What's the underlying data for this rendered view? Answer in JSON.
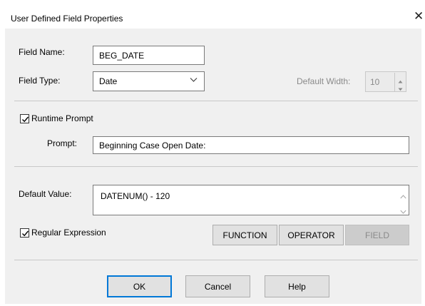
{
  "dialog": {
    "title": "User Defined Field Properties",
    "close_glyph": "✕"
  },
  "field_name": {
    "label": "Field Name:",
    "value": "BEG_DATE"
  },
  "field_type": {
    "label": "Field Type:",
    "value": "Date"
  },
  "default_width": {
    "label": "Default Width:",
    "value": "10",
    "enabled": false
  },
  "runtime_prompt": {
    "label": "Runtime Prompt",
    "checked": true
  },
  "prompt": {
    "label": "Prompt:",
    "value": "Beginning Case Open Date:"
  },
  "default_value": {
    "label": "Default Value:",
    "value": "DATENUM() - 120"
  },
  "regular_expression": {
    "label": "Regular Expression",
    "checked": true
  },
  "expression_buttons": {
    "function_label": "FUNCTION",
    "operator_label": "OPERATOR",
    "field_label": "FIELD",
    "field_enabled": false
  },
  "footer_buttons": {
    "ok_label": "OK",
    "cancel_label": "Cancel",
    "help_label": "Help"
  },
  "colors": {
    "dialog_background": "#f0f0f0",
    "title_background": "#ffffff",
    "default_button_border": "#0078d7",
    "disabled_text": "#8a8a8a"
  },
  "icons": {
    "close": "close-icon",
    "dropdown": "chevron-down-icon",
    "spin_up": "spin-up-icon",
    "spin_down": "spin-down-icon",
    "check": "checkmark-icon",
    "scroll_up": "scroll-up-icon",
    "scroll_down": "scroll-down-icon"
  }
}
